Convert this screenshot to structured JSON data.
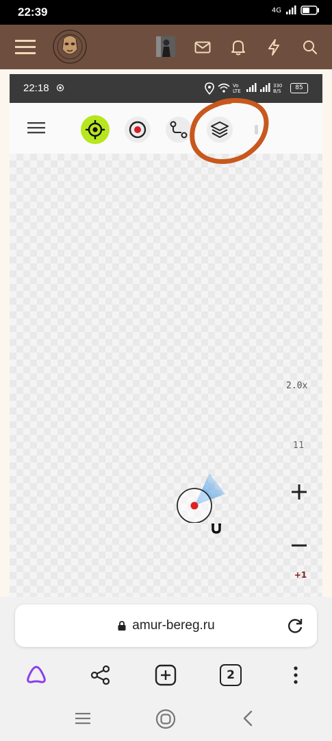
{
  "status_bar": {
    "time": "22:39",
    "network": "4G"
  },
  "inner_status_bar": {
    "time": "22:18",
    "network": "Vo LTE",
    "speed": "330 B/S",
    "battery": "85"
  },
  "map": {
    "zoom_level": "2.0x",
    "zoom_value": "11",
    "plus_one_label": "+1"
  },
  "browser": {
    "url": "amur-bereg.ru",
    "tab_count": "2"
  },
  "colors": {
    "header_bg": "#6e4f3f",
    "annotation": "#c8581e",
    "accent_green": "#b8e61e"
  }
}
